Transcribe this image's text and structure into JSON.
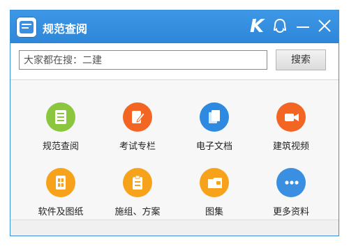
{
  "window": {
    "title": "规范查阅"
  },
  "titlebar_icons": [
    "k-logo-icon",
    "qq-icon",
    "minimize-icon",
    "close-icon"
  ],
  "search": {
    "value": "大家都在搜：二建",
    "button_label": "搜索"
  },
  "tiles": [
    {
      "label": "规范查阅",
      "icon": "document-list-icon",
      "color": "#8cc63f"
    },
    {
      "label": "考试专栏",
      "icon": "exam-edit-icon",
      "color": "#f26522"
    },
    {
      "label": "电子文档",
      "icon": "e-document-icon",
      "color": "#2d8ae0"
    },
    {
      "label": "建筑视频",
      "icon": "video-camera-icon",
      "color": "#f26522"
    },
    {
      "label": "软件及图纸",
      "icon": "software-drawing-icon",
      "color": "#f7a21b"
    },
    {
      "label": "施组、方案",
      "icon": "clipboard-plan-icon",
      "color": "#f7a21b"
    },
    {
      "label": "图集",
      "icon": "folder-atlas-icon",
      "color": "#f7a21b"
    },
    {
      "label": "更多资料",
      "icon": "more-dots-icon",
      "color": "#3a8fe0"
    }
  ]
}
